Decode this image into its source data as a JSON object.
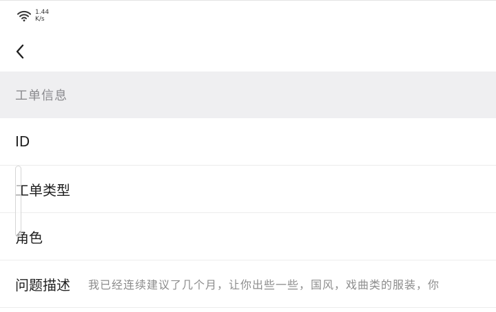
{
  "status_bar": {
    "speed_value": "1.44",
    "speed_unit": "K/s"
  },
  "nav": {
    "back_icon": "chevron-left-icon"
  },
  "section": {
    "title": "工单信息"
  },
  "rows": [
    {
      "label": "ID",
      "value": ""
    },
    {
      "label": "工单类型",
      "value": ""
    },
    {
      "label": "角色",
      "value": ""
    },
    {
      "label": "问题描述",
      "value": "我已经连续建议了几个月，让你出些一些，国风，戏曲类的服装，你"
    }
  ],
  "colors": {
    "section_bg": "#efeff1",
    "label": "#1f1f1f",
    "secondary": "#8c8c8c"
  }
}
